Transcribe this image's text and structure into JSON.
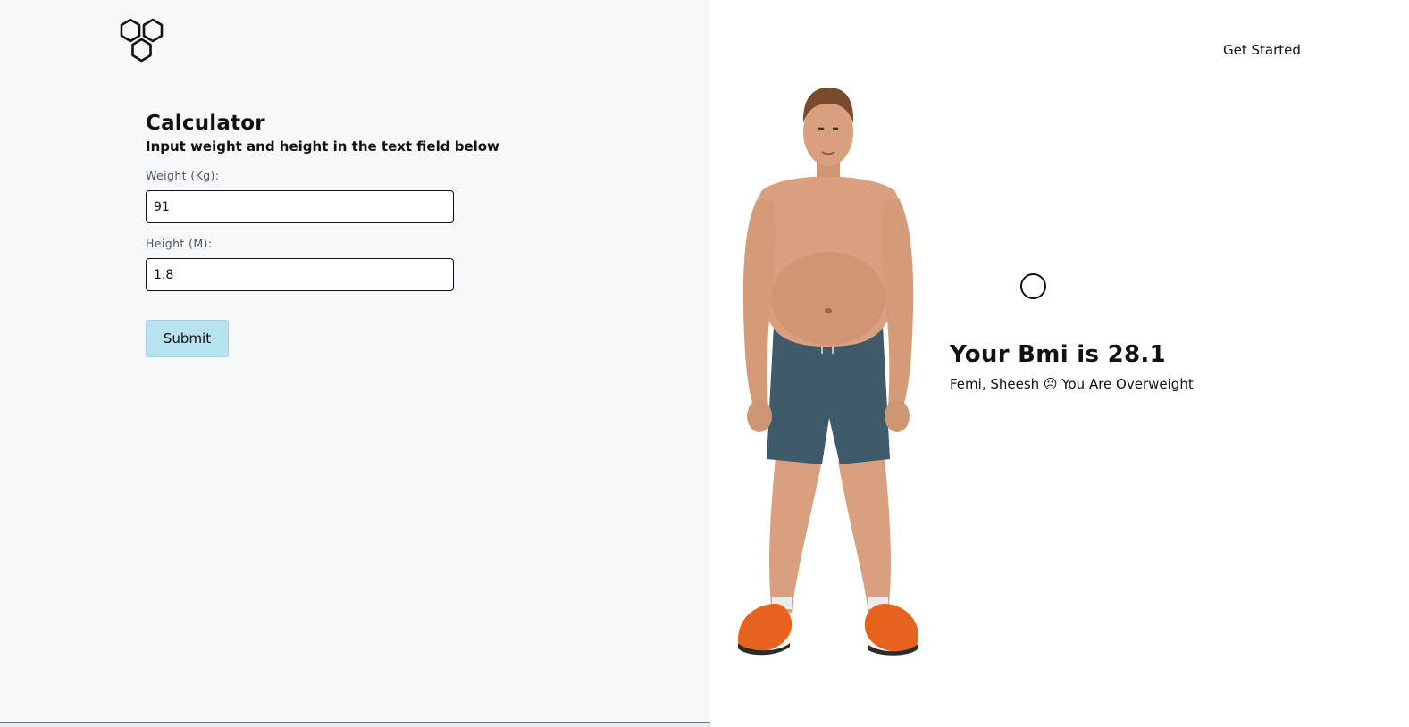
{
  "brand": {
    "logo_icon": "hexagon-cluster-icon"
  },
  "calculator": {
    "title": "Calculator",
    "subtitle": "Input weight and height in the text field below",
    "weight_label": "Weight (Kg):",
    "weight_value": "91",
    "height_label": "Height (M):",
    "height_value": "1.8",
    "submit_label": "Submit"
  },
  "nav": {
    "get_started": "Get Started"
  },
  "result": {
    "title": "Your Bmi is 28.1",
    "message": "Femi, Sheesh ☹ You Are Overweight",
    "loader_icon": "circle-icon",
    "illustration": "overweight-man-illustration"
  },
  "colors": {
    "left_background": "#f6f8fb",
    "right_background": "#ffffff",
    "submit_button": "#b6e3ef",
    "text": "#111111"
  }
}
